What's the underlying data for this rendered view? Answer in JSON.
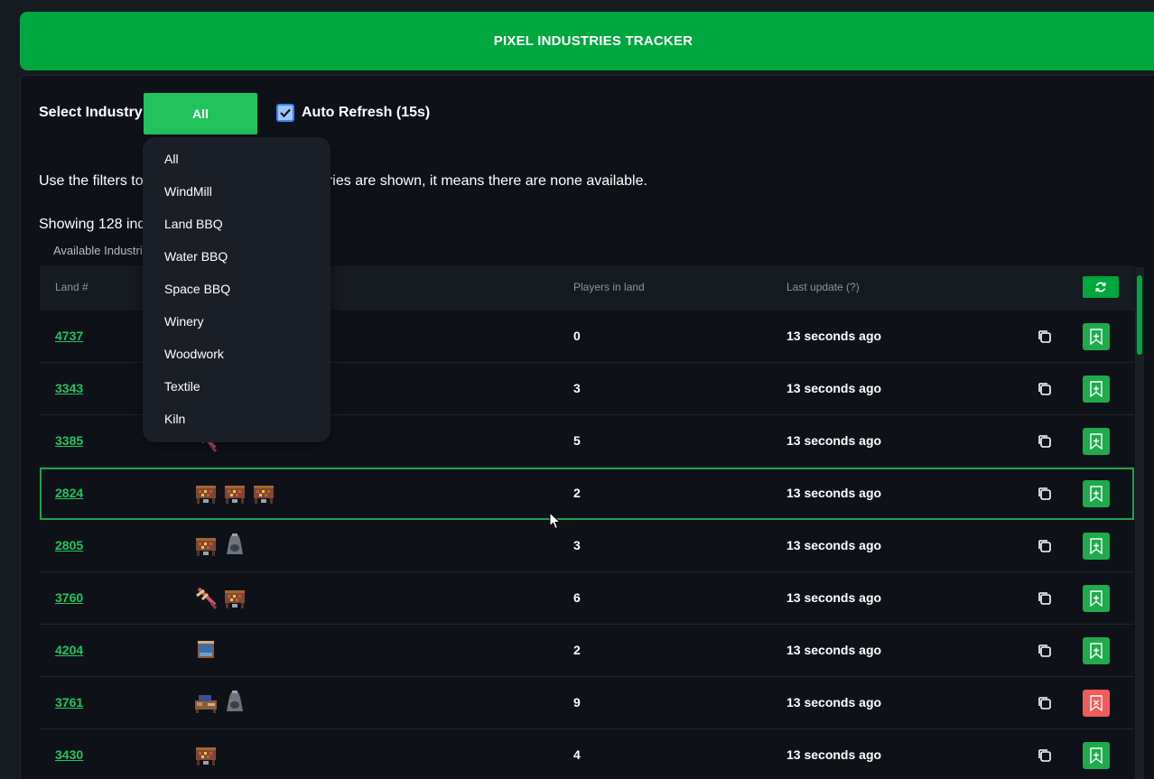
{
  "header": {
    "title": "PIXEL INDUSTRIES TRACKER"
  },
  "controls": {
    "select_label": "Select Industry:",
    "select_value": "All",
    "auto_refresh_label": "Auto Refresh (15s)",
    "auto_refresh_checked": true
  },
  "info": {
    "filters_text": "Use the filters to",
    "filters_text_tail": "stries are shown, it means there are none available.",
    "showing_text": "Showing 128 indu",
    "available_label": "Available Industri"
  },
  "dropdown": {
    "options": [
      "All",
      "WindMill",
      "Land BBQ",
      "Water BBQ",
      "Space BBQ",
      "Winery",
      "Woodwork",
      "Textile",
      "Kiln"
    ]
  },
  "table": {
    "columns": {
      "land": "Land #",
      "players": "Players in land",
      "last_update": "Last update (?)"
    },
    "rows": [
      {
        "land": "4737",
        "players": "0",
        "updated": "13 seconds ago",
        "icons": [],
        "bookmark": "green"
      },
      {
        "land": "3343",
        "players": "3",
        "updated": "13 seconds ago",
        "icons": [],
        "bookmark": "green"
      },
      {
        "land": "3385",
        "players": "5",
        "updated": "13 seconds ago",
        "icons": [
          "windmill-icon"
        ],
        "bookmark": "green"
      },
      {
        "land": "2824",
        "players": "2",
        "updated": "13 seconds ago",
        "icons": [
          "land-bbq-icon",
          "land-bbq-icon",
          "land-bbq-icon"
        ],
        "bookmark": "green",
        "highlight": true
      },
      {
        "land": "2805",
        "players": "3",
        "updated": "13 seconds ago",
        "icons": [
          "land-bbq-icon",
          "kiln-icon"
        ],
        "bookmark": "green"
      },
      {
        "land": "3760",
        "players": "6",
        "updated": "13 seconds ago",
        "icons": [
          "windmill-icon",
          "land-bbq-icon"
        ],
        "bookmark": "green"
      },
      {
        "land": "4204",
        "players": "2",
        "updated": "13 seconds ago",
        "icons": [
          "water-bbq-icon"
        ],
        "bookmark": "green"
      },
      {
        "land": "3761",
        "players": "9",
        "updated": "13 seconds ago",
        "icons": [
          "woodwork-icon",
          "kiln-icon"
        ],
        "bookmark": "red"
      },
      {
        "land": "3430",
        "players": "4",
        "updated": "13 seconds ago",
        "icons": [
          "land-bbq-icon"
        ],
        "bookmark": "green"
      }
    ]
  },
  "colors": {
    "brand_green": "#00a63e",
    "select_green": "#22c35d",
    "link_green": "#22c55e",
    "bookmark_green": "#1faa4b",
    "bookmark_red": "#f05c5c",
    "background": "#0e1218"
  }
}
